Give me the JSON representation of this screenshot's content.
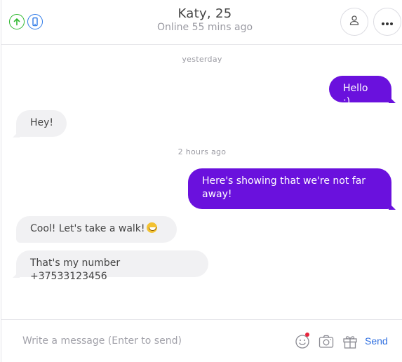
{
  "header": {
    "title": "Katy, 25",
    "status": "Online 55 mins ago",
    "icons": [
      "arrow-up-icon",
      "phone-icon",
      "user-icon",
      "more-icon"
    ]
  },
  "messages": {
    "day_labels": [
      "yesterday",
      "2 hours ago"
    ],
    "items": [
      {
        "direction": "out",
        "text": "Hello :)"
      },
      {
        "direction": "in",
        "text": "Hey!"
      },
      {
        "direction": "out",
        "text": "Here's showing that we're not far away!"
      },
      {
        "direction": "in",
        "text": "Cool! Let's take a walk!",
        "emoji": "grinning-face"
      },
      {
        "direction": "in",
        "text": "That's my number +37533123456"
      }
    ]
  },
  "composer": {
    "placeholder": "Write a message (Enter to send)",
    "value": "",
    "send_label": "Send",
    "icons": [
      "smile-icon",
      "camera-icon",
      "gift-icon"
    ]
  },
  "colors": {
    "accent_purple": "#6a11dd",
    "incoming_bubble": "#f1f1f3",
    "send_blue": "#2f6fe0",
    "online_green": "#2eb82e",
    "notification_red": "#e8243c"
  }
}
